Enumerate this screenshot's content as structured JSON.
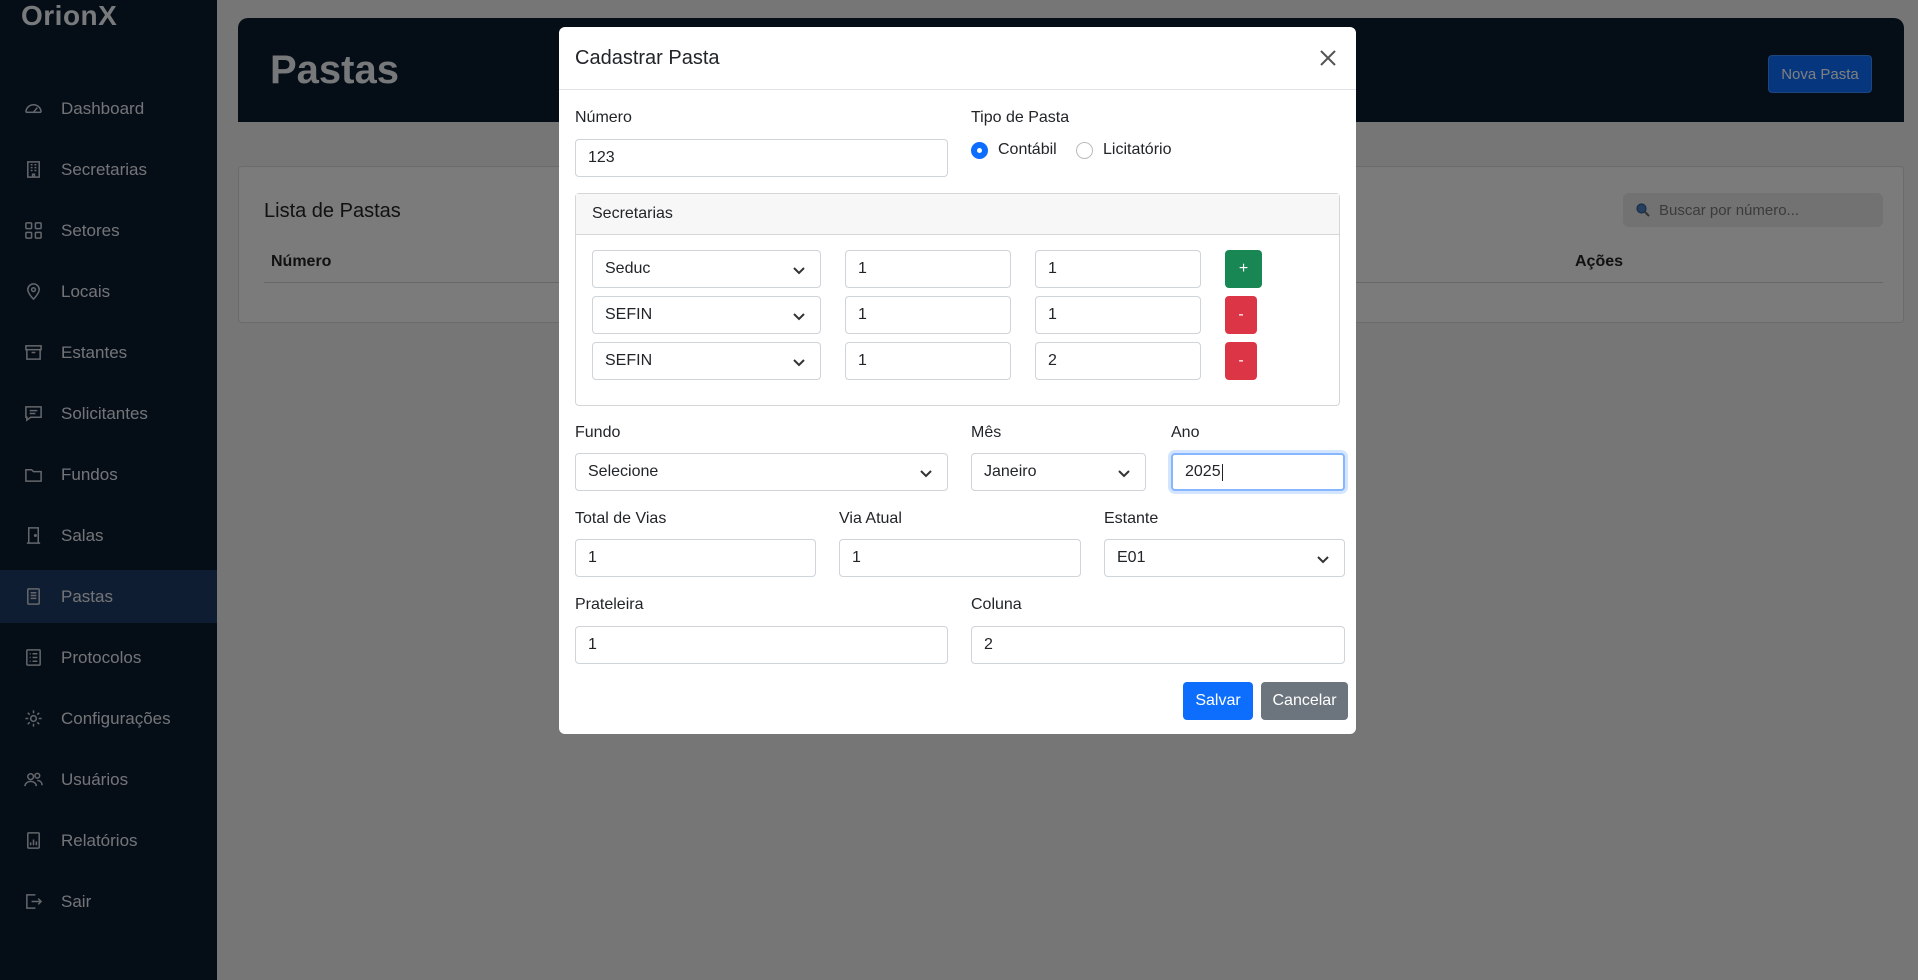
{
  "app": {
    "brand": "OrionX"
  },
  "sidebar": {
    "items": [
      {
        "label": "Dashboard",
        "icon": "dashboard-icon"
      },
      {
        "label": "Secretarias",
        "icon": "building-icon"
      },
      {
        "label": "Setores",
        "icon": "grid-icon"
      },
      {
        "label": "Locais",
        "icon": "location-icon"
      },
      {
        "label": "Estantes",
        "icon": "archive-icon"
      },
      {
        "label": "Solicitantes",
        "icon": "chat-icon"
      },
      {
        "label": "Fundos",
        "icon": "folder-icon"
      },
      {
        "label": "Salas",
        "icon": "door-icon"
      },
      {
        "label": "Pastas",
        "icon": "document-icon",
        "active": true
      },
      {
        "label": "Protocolos",
        "icon": "list-icon"
      },
      {
        "label": "Configurações",
        "icon": "gear-icon"
      },
      {
        "label": "Usuários",
        "icon": "users-icon"
      },
      {
        "label": "Relatórios",
        "icon": "report-icon"
      },
      {
        "label": "Sair",
        "icon": "logout-icon"
      }
    ]
  },
  "header": {
    "title": "Pastas",
    "new_button": "Nova Pasta"
  },
  "list": {
    "title": "Lista de Pastas",
    "search_placeholder": "Buscar por número...",
    "columns": [
      "Número",
      "Ações"
    ]
  },
  "modal": {
    "title": "Cadastrar Pasta",
    "numero_label": "Número",
    "numero_value": "123",
    "tipo_label": "Tipo de Pasta",
    "tipo_options": [
      "Contábil",
      "Licitatório"
    ],
    "tipo_selected": "Contábil",
    "secretarias_label": "Secretarias",
    "secretarias_rows": [
      {
        "secretaria": "Seduc",
        "v1": "1",
        "v2": "1",
        "action": "+"
      },
      {
        "secretaria": "SEFIN",
        "v1": "1",
        "v2": "1",
        "action": "-"
      },
      {
        "secretaria": "SEFIN",
        "v1": "1",
        "v2": "2",
        "action": "-"
      }
    ],
    "fundo_label": "Fundo",
    "fundo_value": "Selecione",
    "mes_label": "Mês",
    "mes_value": "Janeiro",
    "ano_label": "Ano",
    "ano_value": "2025",
    "total_vias_label": "Total de Vias",
    "total_vias_value": "1",
    "via_atual_label": "Via Atual",
    "via_atual_value": "1",
    "estante_label": "Estante",
    "estante_value": "E01",
    "prateleira_label": "Prateleira",
    "prateleira_value": "1",
    "coluna_label": "Coluna",
    "coluna_value": "2",
    "save_label": "Salvar",
    "cancel_label": "Cancelar"
  },
  "colors": {
    "sidebar_bg": "#0b1a2e",
    "sidebar_active": "#1d3b63",
    "primary": "#0d6efd",
    "success": "#198754",
    "danger": "#dc3545",
    "secondary": "#6c757d"
  }
}
